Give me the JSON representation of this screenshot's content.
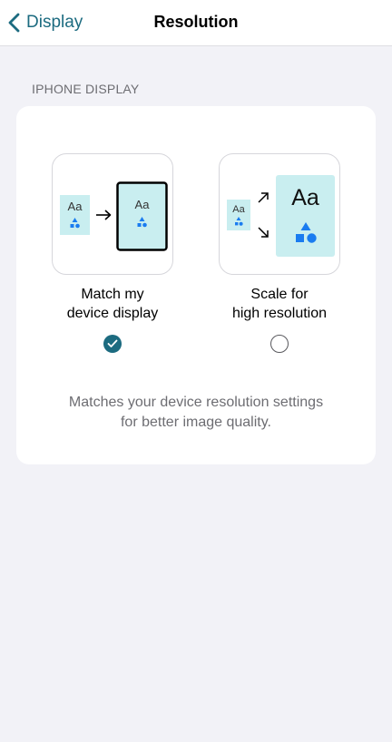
{
  "nav": {
    "back_label": "Display",
    "title": "Resolution"
  },
  "section": {
    "header": "IPHONE DISPLAY"
  },
  "options": [
    {
      "id": "match",
      "label_line1": "Match my",
      "label_line2": "device display",
      "selected": true,
      "illustration_text": "Aa"
    },
    {
      "id": "scale",
      "label_line1": "Scale for",
      "label_line2": "high resolution",
      "selected": false,
      "illustration_text": "Aa"
    }
  ],
  "description": {
    "line1": "Matches your device resolution settings",
    "line2": "for better image quality."
  },
  "colors": {
    "accent": "#1c6b80",
    "tile_fill": "#c9eef0",
    "shape_blue": "#1a7cf0",
    "background": "#f2f2f7"
  }
}
